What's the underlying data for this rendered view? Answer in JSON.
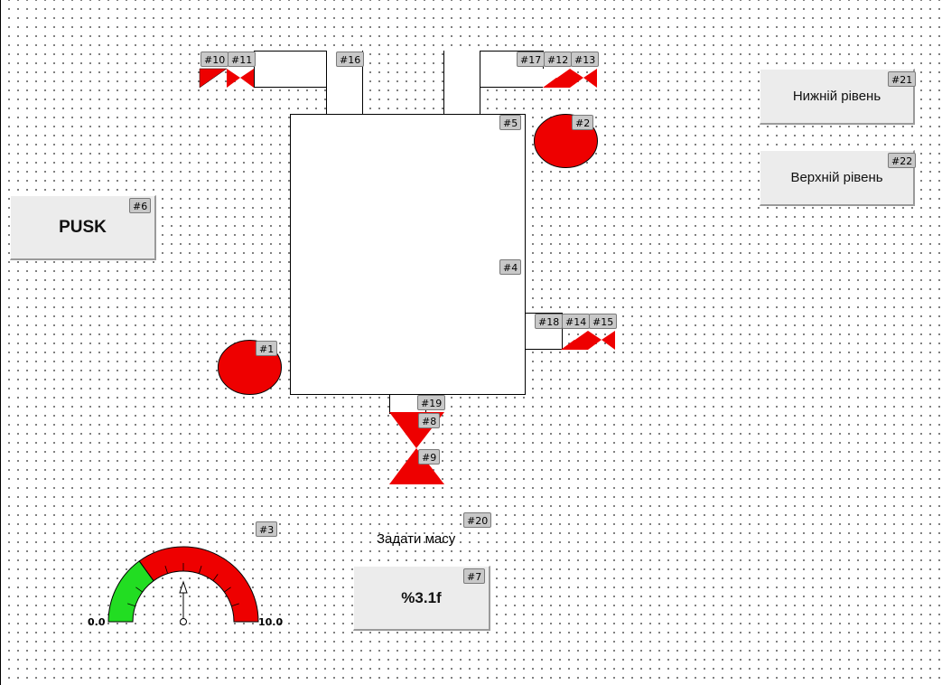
{
  "buttons": {
    "pusk": "PUSK",
    "lower_level": "Нижній рівень",
    "upper_level": "Верхній рівень",
    "mass_value": "%3.1f"
  },
  "labels": {
    "set_mass": "Задати масу"
  },
  "gauge": {
    "min_label": "0.0",
    "max_label": "10.0",
    "min": 0.0,
    "max": 10.0,
    "value": 5.0,
    "green_to": 3.0,
    "colors": {
      "green": "#22dd22",
      "red": "#ee0000"
    }
  },
  "tags": {
    "t1": "#1",
    "t2": "#2",
    "t3": "#3",
    "t4": "#4",
    "t5": "#5",
    "t6": "#6",
    "t7": "#7",
    "t8": "#8",
    "t9": "#9",
    "t10": "#10",
    "t11": "#11",
    "t12": "#12",
    "t13": "#13",
    "t14": "#14",
    "t15": "#15",
    "t16": "#16",
    "t17": "#17",
    "t18": "#18",
    "t19": "#19",
    "t20": "#20",
    "t21": "#21",
    "t22": "#22"
  },
  "colors": {
    "valve": "#ee0000",
    "lamp": "#ee0000",
    "button_bg": "#ececec"
  }
}
